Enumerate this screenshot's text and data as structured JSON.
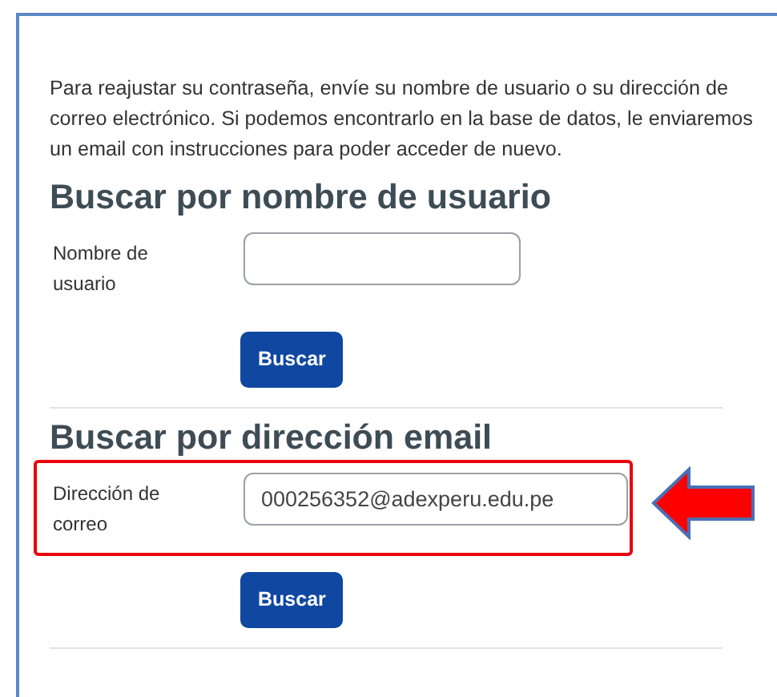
{
  "intro": "Para reajustar su contraseña, envíe su nombre de usuario o su dirección de correo electrónico. Si podemos encontrarlo en la base de datos, le enviaremos un email con instrucciones para poder acceder de nuevo.",
  "sections": [
    {
      "heading": "Buscar por nombre de usuario",
      "label": "Nombre de usuario",
      "button": "Buscar",
      "highlighted": false
    },
    {
      "heading": "Buscar por dirección email",
      "label": "Dirección de correo",
      "value": "000256352@adexperu.edu.pe",
      "button": "Buscar",
      "highlighted": true
    }
  ]
}
